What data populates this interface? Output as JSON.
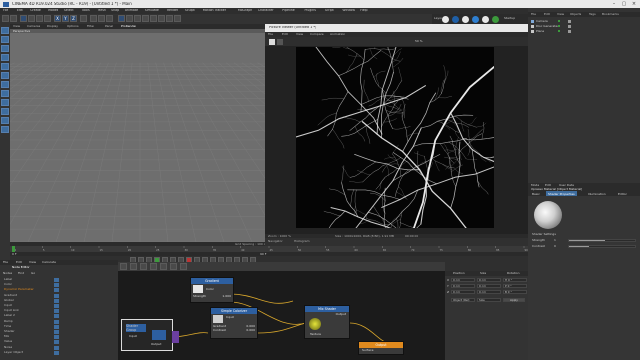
{
  "window": {
    "title": "CINEMA 4D R19.024 Studio (RC - R19) - [Untitled 1 *] - Main"
  },
  "menubar": {
    "items": [
      "File",
      "Edit",
      "Create",
      "Modes",
      "Select",
      "Tools",
      "Mesh",
      "Snap",
      "Animate",
      "Simulate",
      "Render",
      "Sculpt",
      "Motion Tracker",
      "MoGraph",
      "Character",
      "Pipeline",
      "Plugins",
      "Script",
      "Window",
      "Help"
    ]
  },
  "layout": {
    "label": "Layout:",
    "value": "Startup"
  },
  "viewport": {
    "menu": [
      "View",
      "Cameras",
      "Display",
      "Options",
      "Filter",
      "Panel",
      "ProRender"
    ],
    "label": "Perspective",
    "grid_spacing": "Grid Spacing : 100 cm"
  },
  "picture_viewer": {
    "title": "Picture Viewer (Untitled 1 *)",
    "menu": [
      "File",
      "Edit",
      "View",
      "Compare",
      "Animation"
    ],
    "tabs": [
      "Navigator",
      "Histogram"
    ],
    "zoom": "50 %",
    "status_left": "Zoom : 1000 %",
    "status_mid": "Size : 1000x1000, RGB (8 Bit), 1.91 MB",
    "status_right": "00:00:00"
  },
  "object_manager": {
    "menu": [
      "File",
      "Edit",
      "View",
      "Objects",
      "Tags",
      "Bookmarks"
    ],
    "items": [
      {
        "name": "Camera",
        "color": "#7fa9d8"
      },
      {
        "name": "Disc Generated",
        "color": "#c8c8c8"
      },
      {
        "name": "Plane",
        "color": "#c8c8c8"
      }
    ]
  },
  "attributes": {
    "menu": [
      "Mode",
      "Edit",
      "User Data"
    ],
    "title": "Xpresso Material [Object Material]",
    "tabs": [
      "Basic",
      "Shader Properties",
      "Illumination",
      "Editor"
    ],
    "section": "Shader Settings",
    "params": [
      {
        "label": "Strength",
        "value": "1",
        "fill": 0.55
      },
      {
        "label": "Contrast",
        "value": "0",
        "fill": 0.3
      }
    ]
  },
  "timeline": {
    "ticks": [
      "0",
      "5",
      "10",
      "15",
      "20",
      "25",
      "30",
      "35",
      "40",
      "45",
      "50",
      "55",
      "60",
      "65",
      "70",
      "75",
      "80",
      "85",
      "90"
    ],
    "start": "0 F",
    "end": "90 F",
    "current": "0 F"
  },
  "xpresso": {
    "menu": [
      "File",
      "Edit",
      "View",
      "Calculate"
    ],
    "title": "XPresso Editor",
    "tabs": [
      "Node Editor"
    ],
    "left_menu": [
      "Nodes",
      "Find",
      "Go"
    ],
    "tree_items": [
      "Label",
      "Color",
      "Dynamic Parameter",
      "Gradient",
      "Global",
      "Input",
      "Input Link",
      "Label 2",
      "Ramp",
      "Time",
      "Shader",
      "Mix",
      "Value",
      "Noise",
      "Layer Object"
    ],
    "nodes": [
      {
        "title": "Gradient",
        "rows": [
          "Color",
          "Strength"
        ],
        "value": "1.000"
      },
      {
        "title": "Simple Colorizer",
        "rows": [
          "Input",
          "Gradient",
          "Contrast"
        ],
        "values": [
          "0.000",
          "0.000"
        ]
      },
      {
        "title": "Mix Shader",
        "rows": [
          "Texture"
        ],
        "out": "Output"
      },
      {
        "title": "Output",
        "rows": [
          "Surface"
        ]
      },
      {
        "title": "Shader Group",
        "rows": [
          "Input",
          "Output"
        ]
      }
    ]
  },
  "coordinates": {
    "header": [
      "Position",
      "Size",
      "Rotation"
    ],
    "rows": [
      {
        "axis": "X",
        "pos": "0 cm",
        "size": "0 cm",
        "rot": "H 0 °"
      },
      {
        "axis": "Y",
        "pos": "0 cm",
        "size": "0 cm",
        "rot": "P 0 °"
      },
      {
        "axis": "Z",
        "pos": "0 cm",
        "size": "0 cm",
        "rot": "B 0 °"
      }
    ],
    "mode": "Object (Rel)",
    "size_mode": "Size",
    "apply": "Apply"
  },
  "colors": {
    "accent": "#3e6d9f",
    "node_header": "#2d5fa0",
    "node_output": "#e08a1e"
  }
}
